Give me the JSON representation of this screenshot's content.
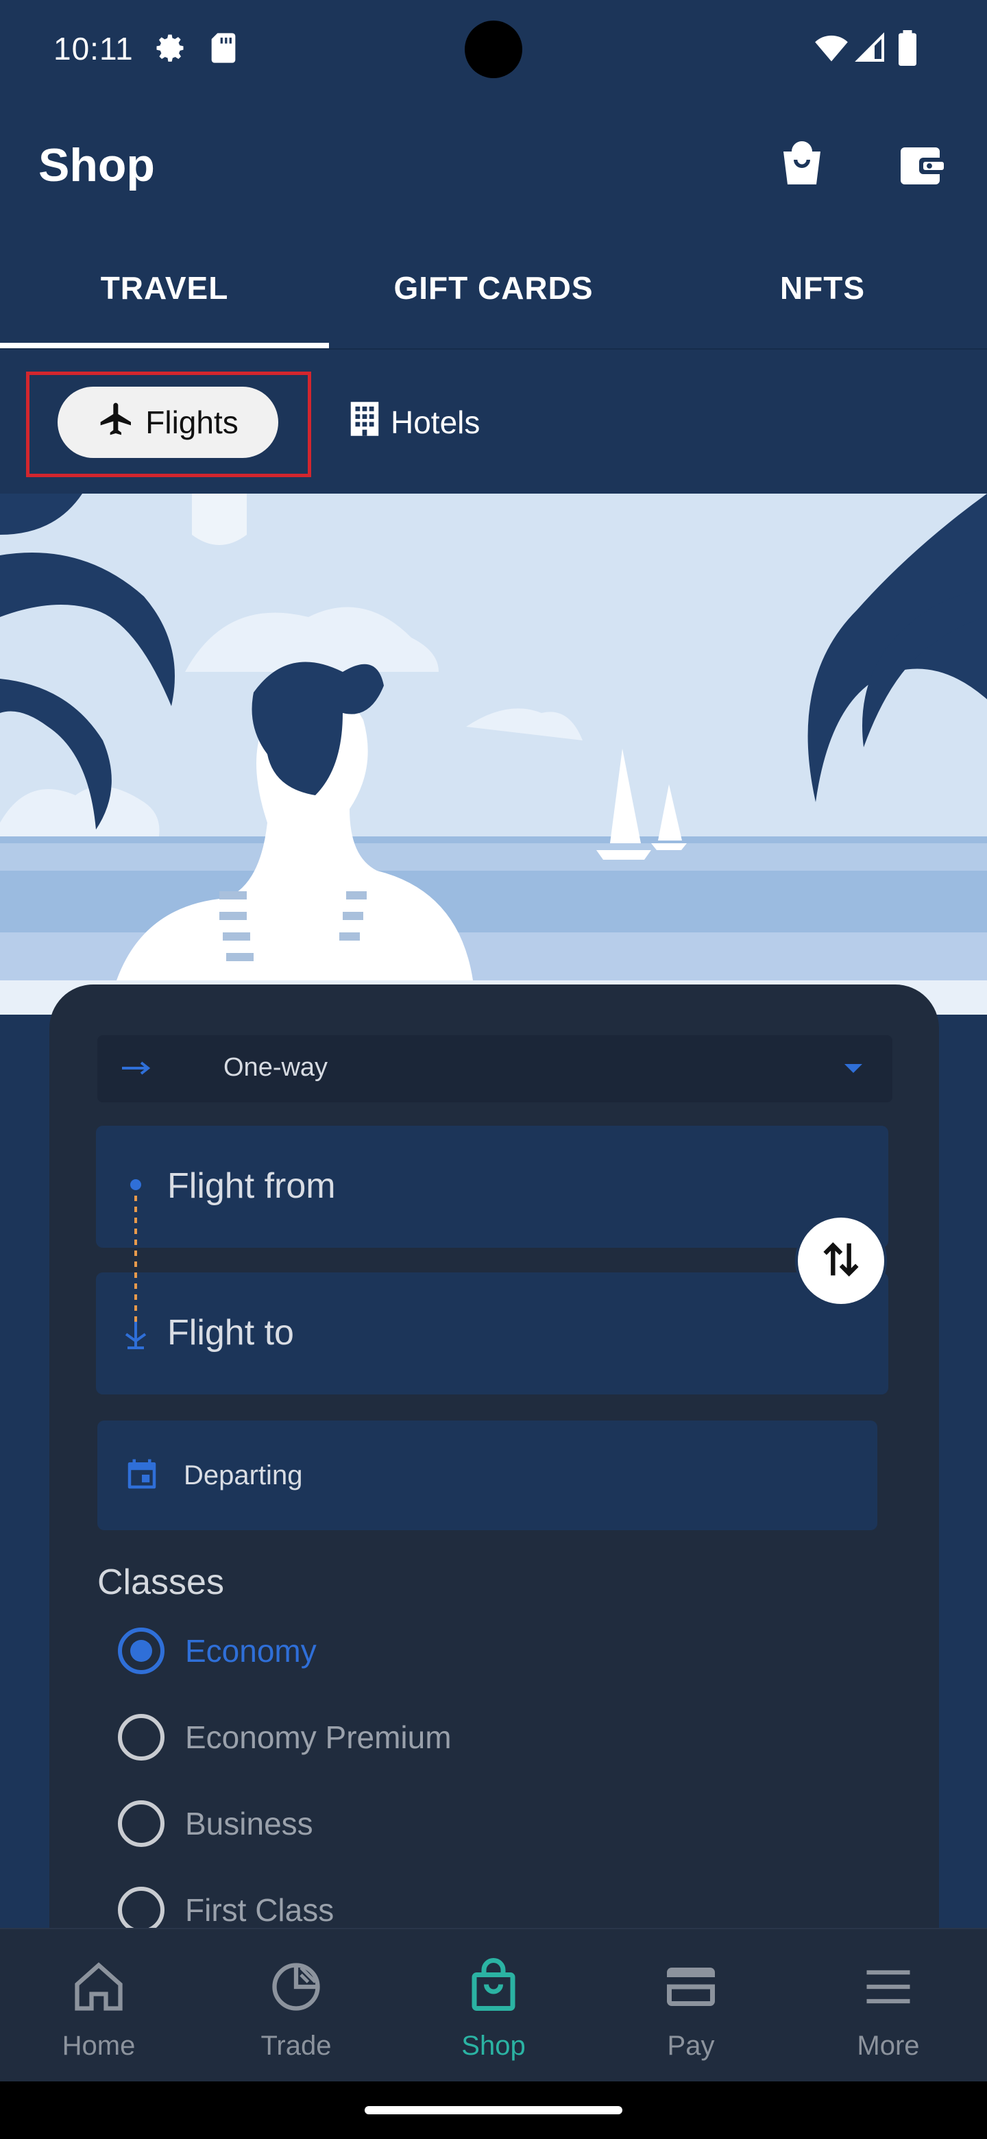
{
  "status_bar": {
    "time": "10:11",
    "icons": [
      "gear-icon",
      "sd-card-icon",
      "wifi-icon",
      "signal-icon",
      "battery-icon"
    ]
  },
  "app_bar": {
    "title": "Shop",
    "actions": [
      "shopping-bag-icon",
      "wallet-icon"
    ]
  },
  "tabs": [
    {
      "label": "TRAVEL",
      "active": true
    },
    {
      "label": "GIFT CARDS",
      "active": false
    },
    {
      "label": "NFTS",
      "active": false
    }
  ],
  "chips": {
    "flights": {
      "label": "Flights",
      "icon": "airplane-icon",
      "selected": true
    },
    "hotels": {
      "label": "Hotels",
      "icon": "building-icon",
      "selected": false
    }
  },
  "form": {
    "trip_type": "One-way",
    "flight_from_placeholder": "Flight from",
    "flight_to_placeholder": "Flight to",
    "departing_placeholder": "Departing",
    "classes_title": "Classes",
    "classes": [
      {
        "label": "Economy",
        "selected": true
      },
      {
        "label": "Economy Premium",
        "selected": false
      },
      {
        "label": "Business",
        "selected": false
      },
      {
        "label": "First Class",
        "selected": false
      }
    ]
  },
  "bottom_nav": [
    {
      "label": "Home",
      "icon": "home-icon",
      "active": false
    },
    {
      "label": "Trade",
      "icon": "pie-chart-icon",
      "active": false
    },
    {
      "label": "Shop",
      "icon": "shopping-bag-icon",
      "active": true
    },
    {
      "label": "Pay",
      "icon": "credit-card-icon",
      "active": false
    },
    {
      "label": "More",
      "icon": "menu-icon",
      "active": false
    }
  ],
  "colors": {
    "primary_bg": "#1c3559",
    "card_bg": "#202c3e",
    "accent_blue": "#2f6fd8",
    "active_nav": "#2bb3a3",
    "highlight": "#d3262e"
  }
}
